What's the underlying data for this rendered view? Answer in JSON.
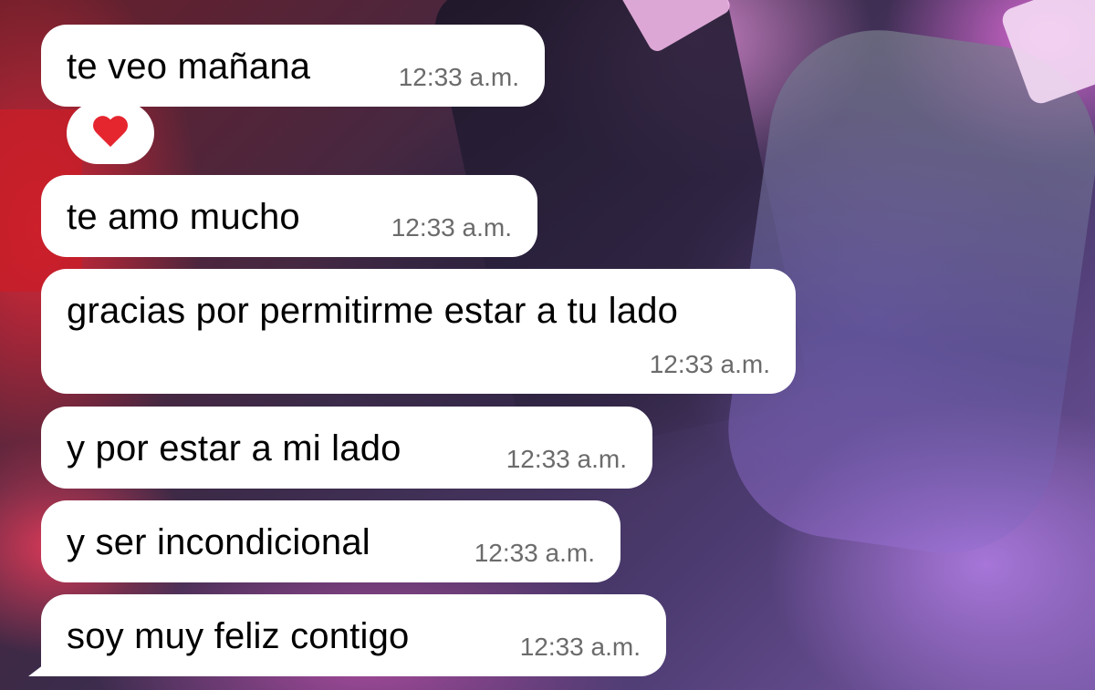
{
  "messages": [
    {
      "text": "te veo mañana",
      "time": "12:33 a.m."
    },
    {
      "text": "te amo mucho",
      "time": "12:33 a.m."
    },
    {
      "text": "gracias por permitirme estar a tu lado",
      "time": "12:33 a.m."
    },
    {
      "text": "y por estar a mi lado",
      "time": "12:33 a.m."
    },
    {
      "text": "y ser incondicional",
      "time": "12:33 a.m."
    },
    {
      "text": "soy muy feliz contigo",
      "time": "12:33 a.m."
    }
  ],
  "reaction": {
    "on_message": 0,
    "icon": "red-heart-icon"
  },
  "colors": {
    "bubble": "#ffffff",
    "text": "#000000",
    "timestamp": "#6b6b6b",
    "heart": "#e5262f"
  }
}
